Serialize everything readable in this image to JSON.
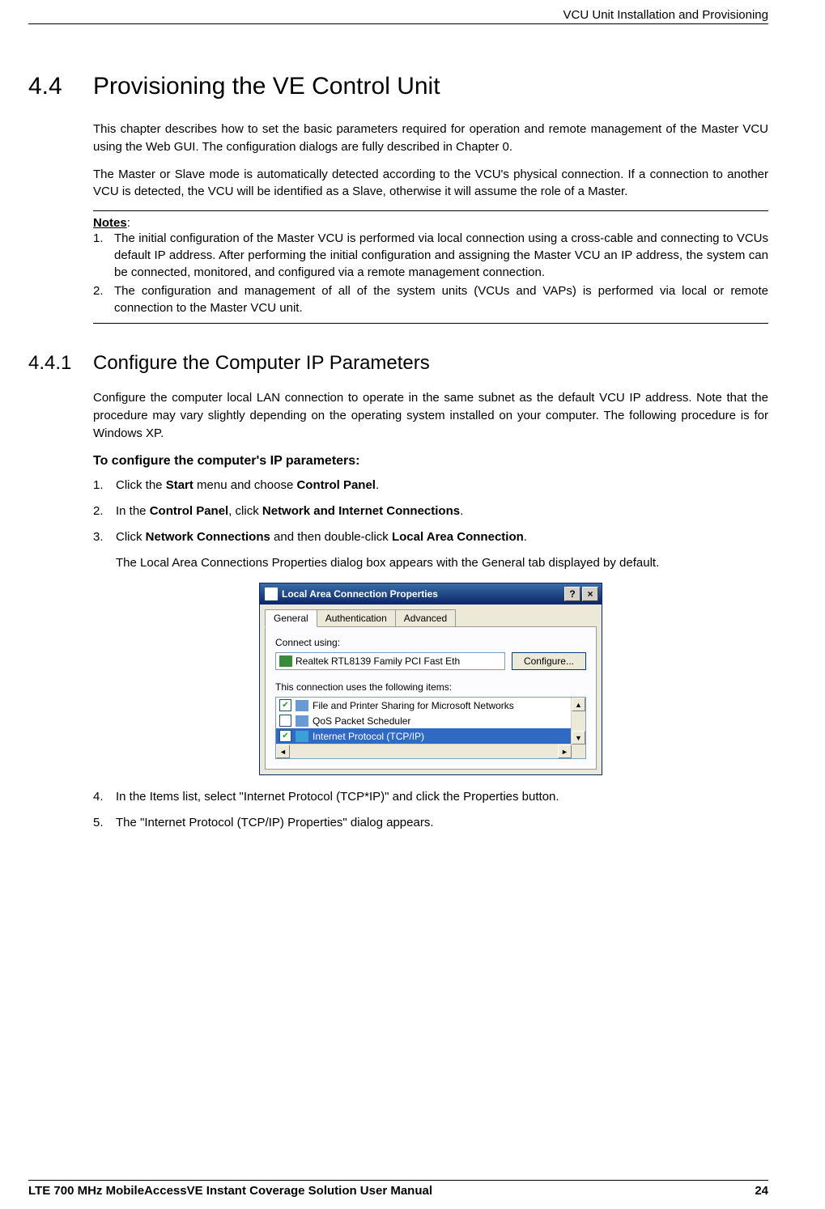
{
  "header": {
    "right": "VCU Unit Installation and Provisioning"
  },
  "h1": {
    "num": "4.4",
    "text": "Provisioning the VE Control Unit"
  },
  "intro": {
    "p1": "This chapter describes how to set the basic parameters required for operation and remote management of the Master VCU using the Web GUI. The configuration dialogs are fully described in Chapter 0.",
    "p2": "The Master or Slave mode is automatically detected according to the VCU's physical connection. If a connection to another VCU is detected, the VCU will be identified as a Slave, otherwise it will assume the role of a Master."
  },
  "notes": {
    "title": "Notes",
    "items": [
      "The initial configuration of the Master VCU is performed via local connection using a cross-cable and connecting to VCUs default IP address. After performing the initial configuration and assigning the Master VCU an IP address, the system can be connected, monitored, and configured via a remote management connection.",
      "The configuration and management of all of the system units (VCUs and VAPs) is performed via local or remote connection to the Master VCU unit."
    ]
  },
  "h2": {
    "num": "4.4.1",
    "text": "Configure the Computer IP Parameters"
  },
  "h2_intro": "Configure the computer local LAN connection to operate in the same subnet as the default VCU IP address. Note that the procedure may vary slightly depending on the operating system installed on your computer. The following procedure is for Windows XP.",
  "procedure_title": "To configure the computer's IP parameters:",
  "steps": {
    "s1": {
      "pre": "Click the ",
      "b1": "Start",
      "mid": " menu and choose ",
      "b2": "Control Panel",
      "post": "."
    },
    "s2": {
      "pre": "In the ",
      "b1": "Control Panel",
      "mid": ", click ",
      "b2": "Network and Internet Connections",
      "post": "."
    },
    "s3": {
      "pre": "Click ",
      "b1": "Network Connections",
      "mid": " and then double-click ",
      "b2": "Local Area Connection",
      "post": "."
    },
    "s3_extra": "The Local Area Connections Properties dialog box appears with the General tab displayed by default.",
    "s4": "In the Items list, select \"Internet Protocol (TCP*IP)\" and click the Properties button.",
    "s5": "The \"Internet Protocol (TCP/IP) Properties\" dialog appears."
  },
  "dialog": {
    "title": "Local Area Connection Properties",
    "tabs": [
      "General",
      "Authentication",
      "Advanced"
    ],
    "connect_label": "Connect using:",
    "adapter": "Realtek RTL8139 Family PCI Fast Eth",
    "configure_btn": "Configure...",
    "items_label": "This connection uses the following items:",
    "items": [
      {
        "checked": true,
        "label": "File and Printer Sharing for Microsoft Networks",
        "selected": false
      },
      {
        "checked": false,
        "label": "QoS Packet Scheduler",
        "selected": false
      },
      {
        "checked": true,
        "label": "Internet Protocol (TCP/IP)",
        "selected": true
      }
    ]
  },
  "footer": {
    "left": "LTE 700 MHz MobileAccessVE Instant Coverage Solution User Manual",
    "right": "24"
  }
}
